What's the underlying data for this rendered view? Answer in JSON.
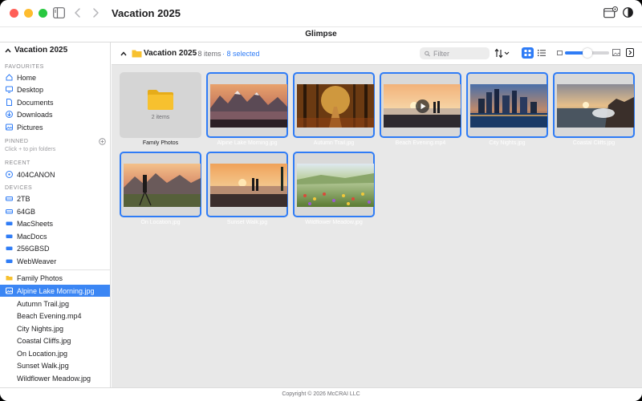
{
  "window": {
    "title": "Vacation 2025",
    "app_name": "Glimpse"
  },
  "sidebar": {
    "header": "Vacation 2025",
    "sections": {
      "favourites": "FAVOURITES",
      "pinned": "PINNED",
      "pinned_hint": "Click + to pin folders",
      "recent": "RECENT",
      "devices": "DEVICES"
    },
    "favourites": [
      {
        "label": "Home",
        "icon": "home-icon"
      },
      {
        "label": "Desktop",
        "icon": "desktop-icon"
      },
      {
        "label": "Documents",
        "icon": "document-icon"
      },
      {
        "label": "Downloads",
        "icon": "downloads-icon"
      },
      {
        "label": "Pictures",
        "icon": "pictures-icon"
      }
    ],
    "recent": [
      {
        "label": "404CANON",
        "icon": "disc-icon"
      }
    ],
    "devices": [
      {
        "label": "2TB",
        "icon": "drive-icon"
      },
      {
        "label": "64GB",
        "icon": "drive-icon"
      },
      {
        "label": "MacSheets",
        "icon": "drive-icon"
      },
      {
        "label": "MacDocs",
        "icon": "drive-icon"
      },
      {
        "label": "256GBSD",
        "icon": "drive-icon"
      },
      {
        "label": "WebWeaver",
        "icon": "drive-icon"
      }
    ],
    "tree": [
      {
        "label": "Family Photos",
        "icon": "folder-icon"
      },
      {
        "label": "Alpine Lake Morning.jpg",
        "icon": "image-icon",
        "selected": true
      },
      {
        "label": "Autumn Trail.jpg"
      },
      {
        "label": "Beach Evening.mp4"
      },
      {
        "label": "City Nights.jpg"
      },
      {
        "label": "Coastal Cliffs.jpg"
      },
      {
        "label": "On Location.jpg"
      },
      {
        "label": "Sunset Walk.jpg"
      },
      {
        "label": "Wildflower Meadow.jpg"
      }
    ]
  },
  "toolbar": {
    "folder_title": "Vacation 2025",
    "item_count": "· 8 items",
    "selected_count": "· 8 selected",
    "filter_placeholder": "Filter",
    "zoom_level": 0.5
  },
  "grid": {
    "folder": {
      "name": "Family Photos",
      "count": "2 items"
    },
    "items": [
      {
        "name": "Alpine Lake Morning.jpg",
        "selected": true
      },
      {
        "name": "Autumn Trail.jpg",
        "selected": true
      },
      {
        "name": "Beach Evening.mp4",
        "selected": true,
        "video": true
      },
      {
        "name": "City Nights.jpg",
        "selected": true
      },
      {
        "name": "Coastal Cliffs.jpg",
        "selected": true
      },
      {
        "name": "On Location.jpg",
        "selected": true
      },
      {
        "name": "Sunset Walk.jpg",
        "selected": true
      },
      {
        "name": "Wildflower Meadow.jpg",
        "selected": true
      }
    ]
  },
  "footer": {
    "copyright": "Copyright © 2026 McCRAI LLC"
  },
  "colors": {
    "accent": "#2f7cf6",
    "selection": "#3b86f4",
    "folder": "#f7c12f"
  }
}
